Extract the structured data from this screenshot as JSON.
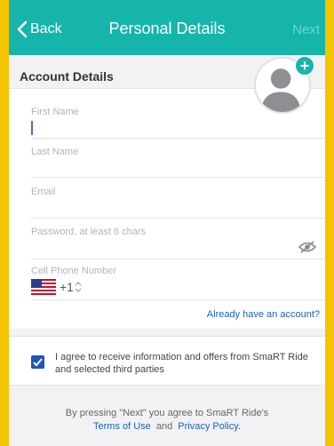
{
  "nav": {
    "back_label": "Back",
    "title": "Personal Details",
    "next_label": "Next"
  },
  "section": {
    "title": "Account Details"
  },
  "avatar": {
    "add_symbol": "+"
  },
  "fields": {
    "first_name_label": "First Name",
    "last_name_label": "Last Name",
    "email_label": "Email",
    "password_label": "Password, at least 6 chars",
    "phone_label": "Cell Phone Number",
    "dial_code": "+1"
  },
  "account_link": "Already have an account?",
  "consent": {
    "checked": true,
    "text": "I agree to receive information and offers from SmaRT Ride and selected third parties"
  },
  "footer": {
    "line1": "By pressing \"Next\" you agree to SmaRT Ride's",
    "terms_label": "Terms of Use",
    "and_label": "and",
    "privacy_label": "Privacy Policy."
  },
  "colors": {
    "border": "#f5c400",
    "navbar": "#15b5ab",
    "link": "#1c5fbe",
    "checkbox": "#1c56b8"
  },
  "icons": {
    "back": "chevron-left-icon",
    "avatar": "person-silhouette-icon",
    "add": "plus-icon",
    "password_toggle": "eye-slash-icon",
    "country": "us-flag-icon",
    "country_select": "up-down-chevron-icon",
    "checkbox": "checkmark-icon"
  }
}
